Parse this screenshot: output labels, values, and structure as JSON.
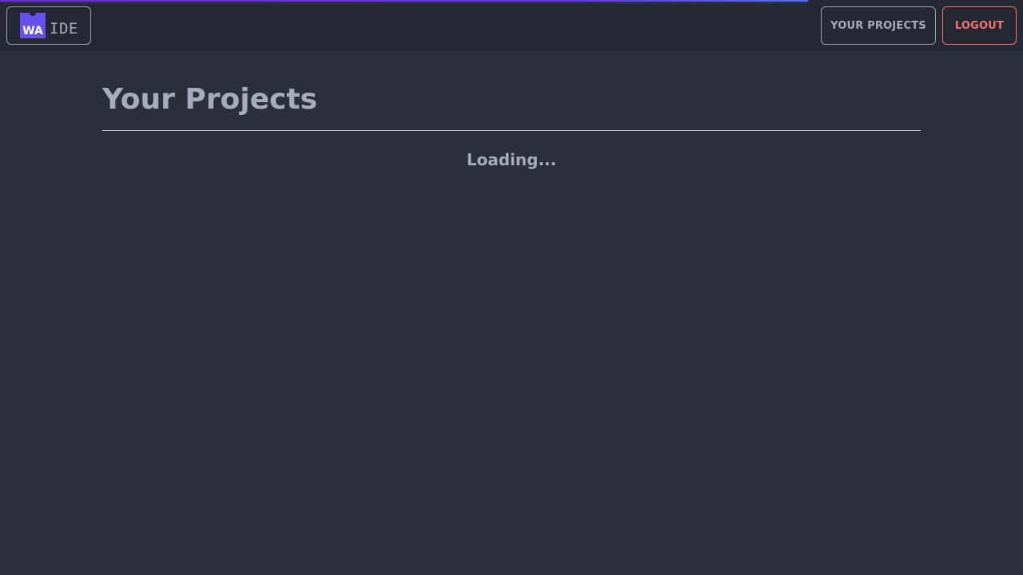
{
  "header": {
    "logo": {
      "mark_text": "WA",
      "text": "IDE",
      "mark_color": "#654ff0"
    },
    "nav": {
      "projects_label": "YOUR PROJECTS",
      "logout_label": "LOGOUT"
    },
    "loading_progress": 0.79
  },
  "main": {
    "title": "Your Projects",
    "status_text": "Loading..."
  },
  "colors": {
    "background": "#2a2f3a",
    "header_background": "#242832",
    "text_muted": "#a6acb8",
    "logout_accent": "#f87171",
    "progress_accent": "#6d28d9"
  }
}
